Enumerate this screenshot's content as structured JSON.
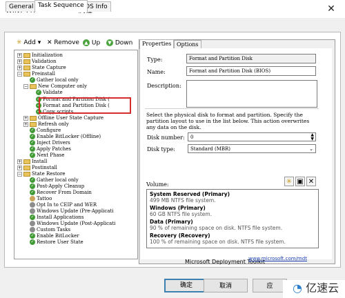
{
  "window": {
    "title": "WIN7 Pro new install 属性",
    "close_glyph": "✕"
  },
  "tabs": [
    {
      "label": "General"
    },
    {
      "label": "Task Sequence"
    },
    {
      "label": "OS Info"
    }
  ],
  "toolbar": {
    "add": "Add ▾",
    "remove": "Remove",
    "up": "Up",
    "down": "Down"
  },
  "tree": [
    {
      "label": "Initialization",
      "type": "folder"
    },
    {
      "label": "Validation",
      "type": "folder"
    },
    {
      "label": "State Capture",
      "type": "folder"
    },
    {
      "label": "Preinstall",
      "type": "folder"
    },
    {
      "label": "Gather local only",
      "type": "check"
    },
    {
      "label": "New Computer only",
      "type": "folder"
    },
    {
      "label": "Validate",
      "type": "check"
    },
    {
      "label": "Format and Partition Disk (",
      "type": "check"
    },
    {
      "label": "Format and Partition Disk (",
      "type": "check"
    },
    {
      "label": "Copy scripts",
      "type": "check"
    },
    {
      "label": "Offline User State Capture",
      "type": "folder"
    },
    {
      "label": "Refresh only",
      "type": "folder"
    },
    {
      "label": "Configure",
      "type": "check"
    },
    {
      "label": "Enable BitLocker (Offline)",
      "type": "check"
    },
    {
      "label": "Inject Drivers",
      "type": "check"
    },
    {
      "label": "Apply Patches",
      "type": "check"
    },
    {
      "label": "Next Phase",
      "type": "check"
    },
    {
      "label": "Install",
      "type": "folder"
    },
    {
      "label": "Postinstall",
      "type": "folder"
    },
    {
      "label": "State Restore",
      "type": "folder"
    },
    {
      "label": "Gather local only",
      "type": "check"
    },
    {
      "label": "Post-Apply Cleanup",
      "type": "check"
    },
    {
      "label": "Recover From Domain",
      "type": "check"
    },
    {
      "label": "Tattoo",
      "type": "tea"
    },
    {
      "label": "Opt In to CEIP and WER",
      "type": "gear"
    },
    {
      "label": "Windows Update (Pre-Applicati",
      "type": "gear"
    },
    {
      "label": "Install Applications",
      "type": "check"
    },
    {
      "label": "Windows Update (Post-Applicati",
      "type": "gear"
    },
    {
      "label": "Custom Tasks",
      "type": "gear"
    },
    {
      "label": "Enable BitLocker",
      "type": "check"
    },
    {
      "label": "Restore User State",
      "type": "check"
    }
  ],
  "right_tabs": [
    {
      "label": "Properties"
    },
    {
      "label": "Options"
    }
  ],
  "properties": {
    "type_label": "Type:",
    "type_value": "Format and Partition Disk",
    "name_label": "Name:",
    "name_value": "Format and Partition Disk (BIOS)",
    "desc_label": "Description:",
    "help_text": "Select the physical disk to format and partition.  Specify the partition layout to use in the list below.  This action overwrites any data on the disk.",
    "disk_number_label": "Disk number:",
    "disk_number_value": "0",
    "disk_type_label": "Disk type:",
    "disk_type_value": "Standard (MBR)",
    "volume_label": "Volume:"
  },
  "volumes": [
    {
      "name": "System Reserved (Primary)",
      "detail": "499 MB NTFS file system."
    },
    {
      "name": "Windows (Primary)",
      "detail": "60 GB NTFS file system."
    },
    {
      "name": "Data (Primary)",
      "detail": "90 % of remaining space on disk. NTFS file system."
    },
    {
      "name": "Recovery (Recovery)",
      "detail": "100 % of remaining space on disk. NTFS file system."
    }
  ],
  "footer": {
    "product": "Microsoft Deployment Toolkit",
    "link": "www.microsoft.com/mdt"
  },
  "buttons": {
    "ok": "确定",
    "cancel": "取消",
    "apply": "应"
  },
  "watermark": "亿速云"
}
